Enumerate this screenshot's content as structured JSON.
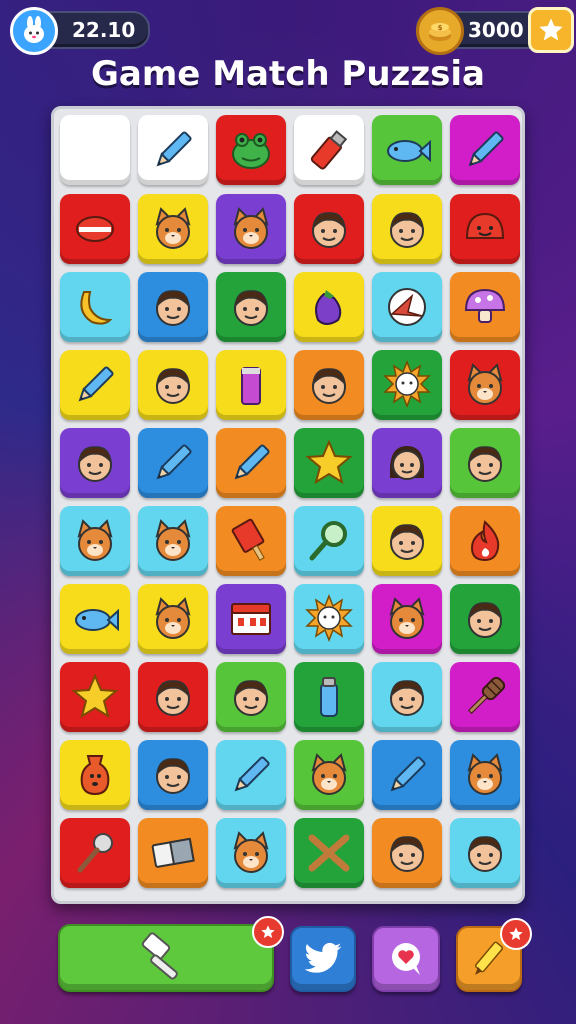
{
  "header": {
    "timer_value": "22.10",
    "coins_value": "3000",
    "avatar_icon": "bunny-avatar-icon",
    "coin_icon": "coin-stack-icon",
    "star_icon": "star-icon"
  },
  "title": "Game Match Puzzsia",
  "colors": {
    "white": "#ffffff",
    "red": "#e01e1e",
    "green": "#56c53a",
    "magenta": "#d21ec8",
    "yellow": "#f6dc1a",
    "purple": "#7a3fd1",
    "cyan": "#62d6ee",
    "blue": "#2d8ee0",
    "dgreen": "#23a33a",
    "orange": "#f28c22",
    "lyellow": "#f5e84a"
  },
  "board": {
    "columns": 6,
    "rows": 10,
    "tiles": [
      {
        "color": "white",
        "icon": "blank"
      },
      {
        "color": "white",
        "icon": "pencil"
      },
      {
        "color": "red",
        "icon": "frog"
      },
      {
        "color": "white",
        "icon": "lighter"
      },
      {
        "color": "green",
        "icon": "fish"
      },
      {
        "color": "magenta",
        "icon": "pencil"
      },
      {
        "color": "red",
        "icon": "lips"
      },
      {
        "color": "yellow",
        "icon": "cat-face"
      },
      {
        "color": "purple",
        "icon": "cat-face"
      },
      {
        "color": "red",
        "icon": "boy-face"
      },
      {
        "color": "yellow",
        "icon": "boy-face"
      },
      {
        "color": "red",
        "icon": "blob"
      },
      {
        "color": "cyan",
        "icon": "banana"
      },
      {
        "color": "blue",
        "icon": "boy-face"
      },
      {
        "color": "dgreen",
        "icon": "boy-face"
      },
      {
        "color": "yellow",
        "icon": "eggplant"
      },
      {
        "color": "cyan",
        "icon": "bird"
      },
      {
        "color": "orange",
        "icon": "mushroom"
      },
      {
        "color": "yellow",
        "icon": "pencil"
      },
      {
        "color": "yellow",
        "icon": "boy-face"
      },
      {
        "color": "yellow",
        "icon": "glue"
      },
      {
        "color": "orange",
        "icon": "boy-face"
      },
      {
        "color": "dgreen",
        "icon": "sun-face"
      },
      {
        "color": "red",
        "icon": "cat-face"
      },
      {
        "color": "purple",
        "icon": "boy-face"
      },
      {
        "color": "blue",
        "icon": "pencil"
      },
      {
        "color": "orange",
        "icon": "pencil"
      },
      {
        "color": "dgreen",
        "icon": "star"
      },
      {
        "color": "purple",
        "icon": "girl-face"
      },
      {
        "color": "green",
        "icon": "boy-face"
      },
      {
        "color": "cyan",
        "icon": "cat-face"
      },
      {
        "color": "cyan",
        "icon": "cat-face"
      },
      {
        "color": "orange",
        "icon": "popsicle"
      },
      {
        "color": "cyan",
        "icon": "magnifier"
      },
      {
        "color": "yellow",
        "icon": "boy-face"
      },
      {
        "color": "orange",
        "icon": "flame"
      },
      {
        "color": "yellow",
        "icon": "fish"
      },
      {
        "color": "yellow",
        "icon": "cat-face"
      },
      {
        "color": "purple",
        "icon": "box"
      },
      {
        "color": "cyan",
        "icon": "sun-face"
      },
      {
        "color": "magenta",
        "icon": "cat-face"
      },
      {
        "color": "dgreen",
        "icon": "boy-face"
      },
      {
        "color": "red",
        "icon": "star"
      },
      {
        "color": "red",
        "icon": "boy-face"
      },
      {
        "color": "green",
        "icon": "boy-face"
      },
      {
        "color": "dgreen",
        "icon": "bottle"
      },
      {
        "color": "cyan",
        "icon": "boy-face"
      },
      {
        "color": "magenta",
        "icon": "honey-dipper"
      },
      {
        "color": "yellow",
        "icon": "vase"
      },
      {
        "color": "blue",
        "icon": "boy-face"
      },
      {
        "color": "cyan",
        "icon": "pencil"
      },
      {
        "color": "green",
        "icon": "cat-face"
      },
      {
        "color": "blue",
        "icon": "pencil"
      },
      {
        "color": "blue",
        "icon": "cat-face"
      },
      {
        "color": "red",
        "icon": "mic"
      },
      {
        "color": "orange",
        "icon": "eraser"
      },
      {
        "color": "cyan",
        "icon": "cat-face"
      },
      {
        "color": "dgreen",
        "icon": "crossed-sticks"
      },
      {
        "color": "orange",
        "icon": "boy-face"
      },
      {
        "color": "cyan",
        "icon": "boy-face"
      }
    ]
  },
  "toolbar": {
    "hammer_icon": "hammer-icon",
    "twitter_icon": "twitter-icon",
    "chat_icon": "chat-heart-icon",
    "pencil_icon": "pencil-icon"
  }
}
